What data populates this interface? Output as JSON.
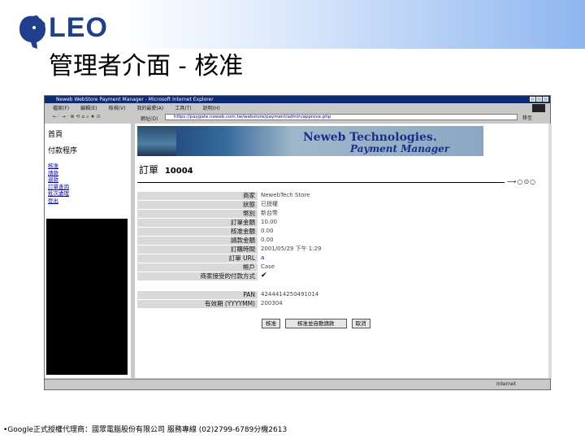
{
  "slide": {
    "logo_text": "LEO",
    "title": "管理者介面 - 核准",
    "footer": "•Google正式授權代理商：國眾電腦股份有限公司 服務專線 (02)2799-6789分機2613"
  },
  "browser": {
    "title": "Neweb WebStore Payment Manager - Microsoft Internet Explorer",
    "menu": [
      "檔案(F)",
      "編輯(E)",
      "檢視(V)",
      "我的最愛(A)",
      "工具(T)",
      "說明(H)"
    ],
    "toolbar_text": "← · → · ⊗ ⟲ ⌂  ⌕ ★ ⊙",
    "address_label": "網址(D)",
    "address": "https://paygate.neweb.com.tw/webstore/payment/admin/approve.php",
    "go_label": "移至",
    "status_zone": "Internet"
  },
  "nav": {
    "home": "首頁",
    "section": "付款程序",
    "links": [
      "核准",
      "請款",
      "退款",
      "訂單查詢",
      "批次處理",
      "登出"
    ]
  },
  "banner": {
    "title": "Neweb Technologies.",
    "subtitle": "Payment Manager"
  },
  "order": {
    "label": "訂單",
    "number": "10004"
  },
  "fields": [
    {
      "label": "商家",
      "value": "NewebTech Store"
    },
    {
      "label": "狀態",
      "value": "已授權"
    },
    {
      "label": "幣別",
      "value": "新台幣"
    },
    {
      "label": "訂單金額",
      "value": "10.00"
    },
    {
      "label": "核准金額",
      "value": "0.00"
    },
    {
      "label": "請款金額",
      "value": "0.00"
    },
    {
      "label": "訂購時間",
      "value": "2001/05/29 下午 1:29"
    },
    {
      "label": "訂單 URL",
      "value": "a"
    },
    {
      "label": "帳戶",
      "value": "Case"
    },
    {
      "label": "商家接受的付款方式",
      "value": "✔"
    },
    {
      "label": "PAN",
      "value": "4244414250491014"
    },
    {
      "label": "有效期 (YYYYMM)",
      "value": "200304"
    }
  ],
  "buttons": {
    "approve": "核准",
    "approve_and_capture": "核准並自動請款",
    "cancel": "取消"
  }
}
